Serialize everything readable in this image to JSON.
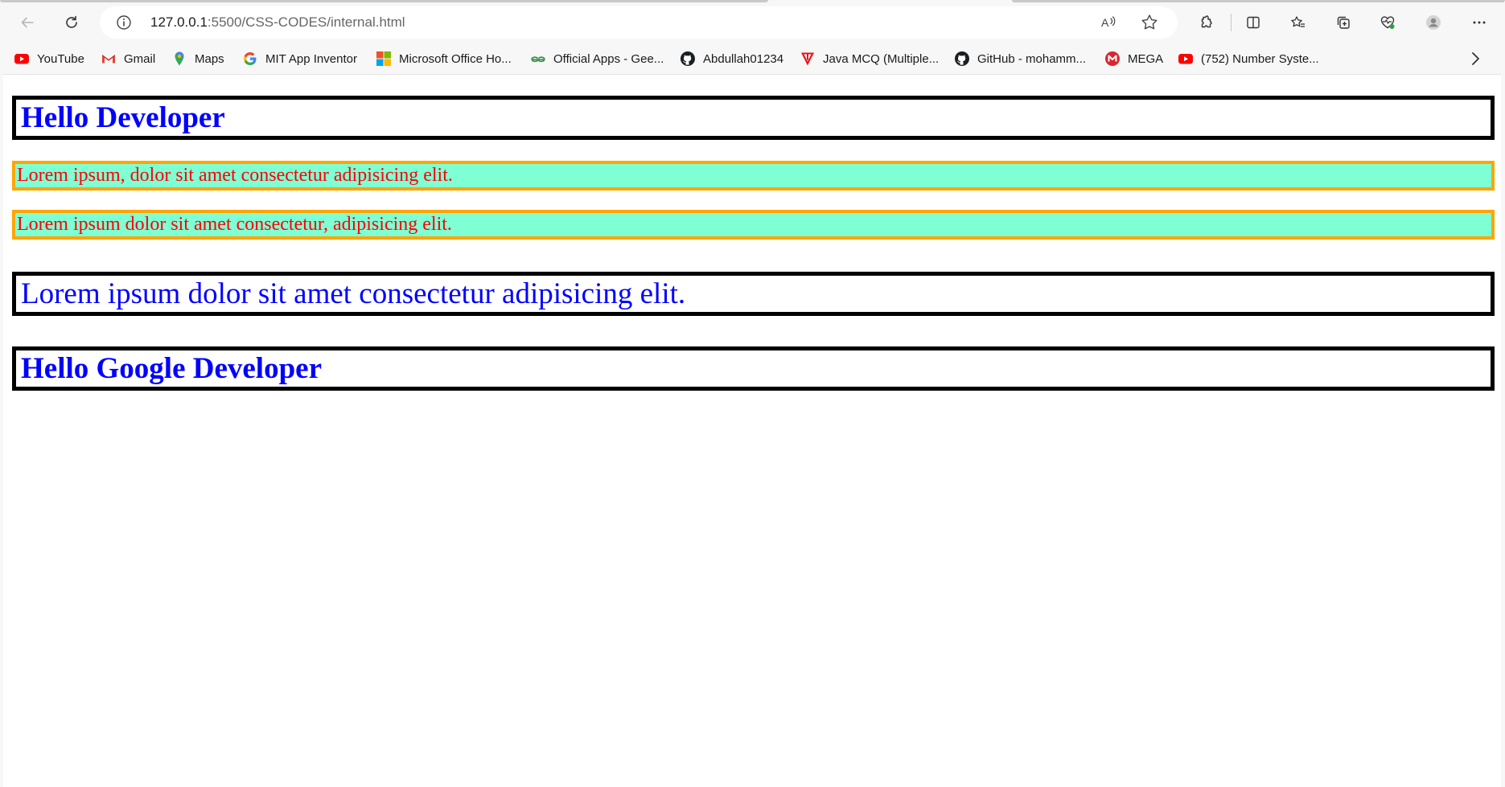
{
  "browser": {
    "url_host": "127.0.0.1",
    "url_rest": ":5500/CSS-CODES/internal.html",
    "toolbar_icons": [
      "back-icon",
      "refresh-icon",
      "info-icon",
      "read-aloud-icon",
      "favorite-star-icon",
      "extensions-icon",
      "split-screen-icon",
      "favorites-icon",
      "collections-icon",
      "browser-essentials-icon",
      "profile-icon",
      "more-icon"
    ]
  },
  "bookmarks": [
    {
      "label": "YouTube",
      "icon": "youtube-icon"
    },
    {
      "label": "Gmail",
      "icon": "gmail-icon"
    },
    {
      "label": "Maps",
      "icon": "maps-icon"
    },
    {
      "label": "MIT App Inventor",
      "icon": "google-icon"
    },
    {
      "label": "Microsoft Office Ho...",
      "icon": "microsoft-icon"
    },
    {
      "label": "Official Apps - Gee...",
      "icon": "geeksforgeeks-icon"
    },
    {
      "label": "Abdullah01234",
      "icon": "github-icon"
    },
    {
      "label": "Java MCQ (Multiple...",
      "icon": "testbook-icon"
    },
    {
      "label": "GitHub - mohamm...",
      "icon": "github-icon"
    },
    {
      "label": "MEGA",
      "icon": "mega-icon"
    },
    {
      "label": "(752) Number Syste...",
      "icon": "youtube-icon"
    }
  ],
  "page": {
    "heading1": "Hello Developer",
    "para1": "Lorem ipsum, dolor sit amet consectetur adipisicing elit.",
    "para2": "Lorem ipsum dolor sit amet consectetur, adipisicing elit.",
    "big_text": "Lorem ipsum dolor sit amet consectetur adipisicing elit.",
    "heading2": "Hello Google Developer"
  },
  "colors": {
    "heading_text": "#0000ff",
    "para_text": "#ff0000",
    "para_background": "#7fffd4",
    "para_border": "#ffa500",
    "box_border": "#000000"
  }
}
